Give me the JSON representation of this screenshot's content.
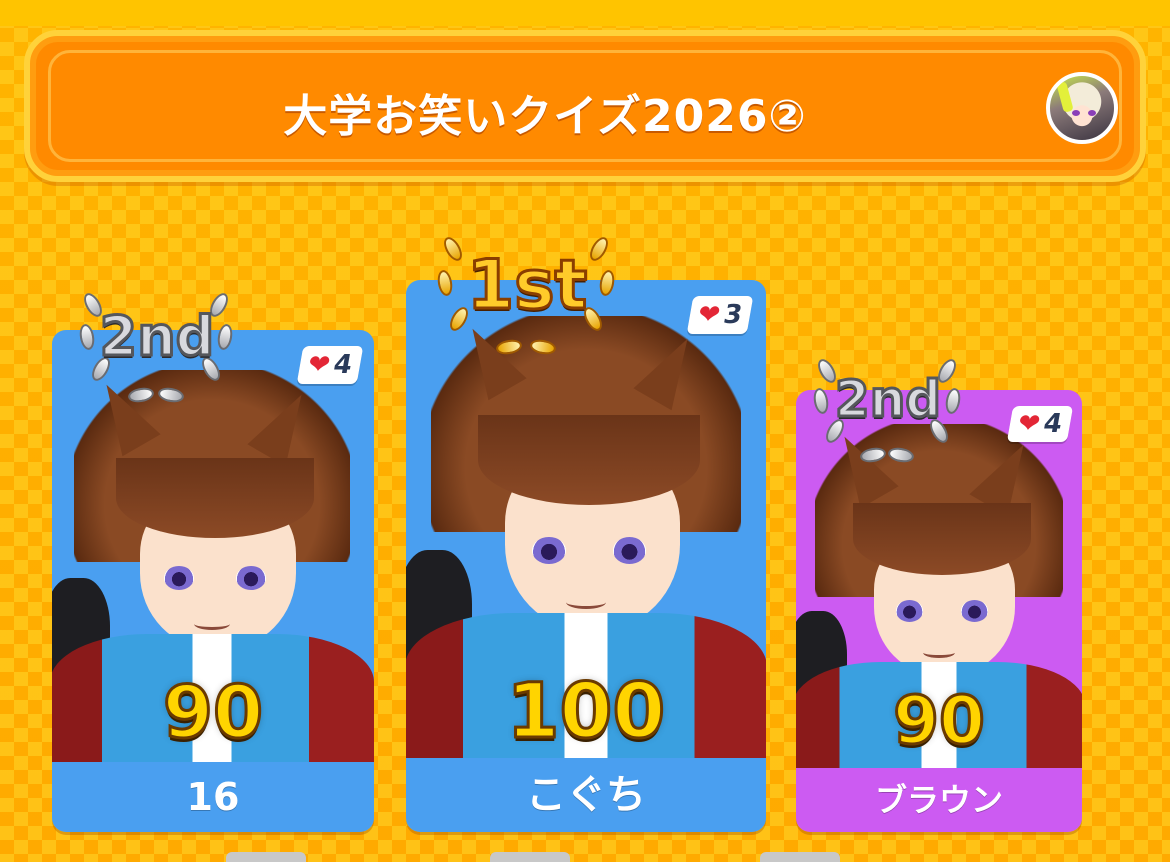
{
  "header": {
    "title": "大学お笑いクイズ2026②",
    "host_avatar_icon": "host-avatar"
  },
  "colors": {
    "background": "#ffb000",
    "header_bg": "#ff8a00",
    "card_blue": "#4a9ff0",
    "card_purple": "#cc5bf2",
    "score_gold": "#ffd400",
    "heart_red": "#e32636"
  },
  "players": [
    {
      "rank": "2nd",
      "rank_style": "silver",
      "hearts": "4",
      "score": "90",
      "name": "16",
      "card_color": "blue"
    },
    {
      "rank": "1st",
      "rank_style": "gold",
      "hearts": "3",
      "score": "100",
      "name": "こぐち",
      "card_color": "blue"
    },
    {
      "rank": "2nd",
      "rank_style": "silver",
      "hearts": "4",
      "score": "90",
      "name": "ブラウン",
      "card_color": "purple"
    }
  ]
}
